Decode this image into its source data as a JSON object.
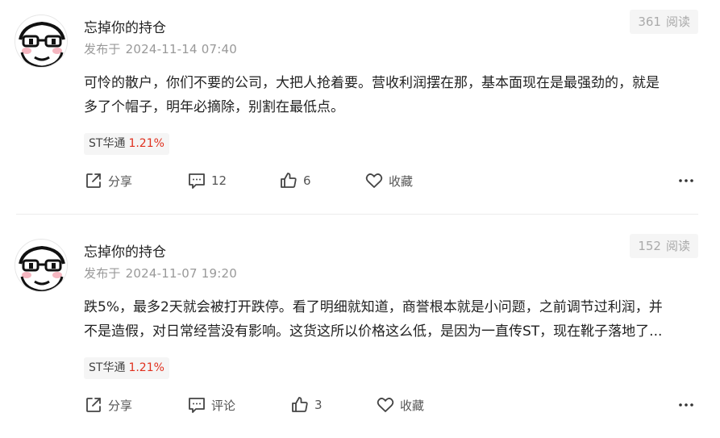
{
  "posts": [
    {
      "username": "忘掉你的持仓",
      "published_label": "发布于",
      "published_time": "2024-11-14 07:40",
      "reads_count": "361",
      "reads_label": "阅读",
      "content_lines": [
        "可怜的散户，你们不要的公司，大把人抢着要。营收利润摆在那，基本面现在是最强劲的，就是",
        "多了个帽子，明年必摘除，别割在最低点。"
      ],
      "stock_tag": {
        "name": "ST华通",
        "change": "1.21%"
      },
      "actions": {
        "share": "分享",
        "comment": "12",
        "like": "6",
        "favorite": "收藏"
      }
    },
    {
      "username": "忘掉你的持仓",
      "published_label": "发布于",
      "published_time": "2024-11-07 19:20",
      "reads_count": "152",
      "reads_label": "阅读",
      "content_lines": [
        "跌5%，最多2天就会被打开跌停。看了明细就知道，商誉根本就是小问题，之前调节过利润，并",
        "不是造假，对日常经营没有影响。这货这所以价格这么低，是因为一直传ST，现在靴子落地了..."
      ],
      "stock_tag": {
        "name": "ST华通",
        "change": "1.21%"
      },
      "actions": {
        "share": "分享",
        "comment": "评论",
        "like": "3",
        "favorite": "收藏"
      }
    }
  ],
  "colors": {
    "up": "#e0301e",
    "muted": "#999999",
    "text": "#222222"
  },
  "icons": {
    "avatar": "cartoon-face-avatar",
    "share": "share-icon",
    "comment": "comment-icon",
    "like": "thumbs-up-icon",
    "favorite": "heart-icon",
    "more": "more-dots-icon"
  }
}
